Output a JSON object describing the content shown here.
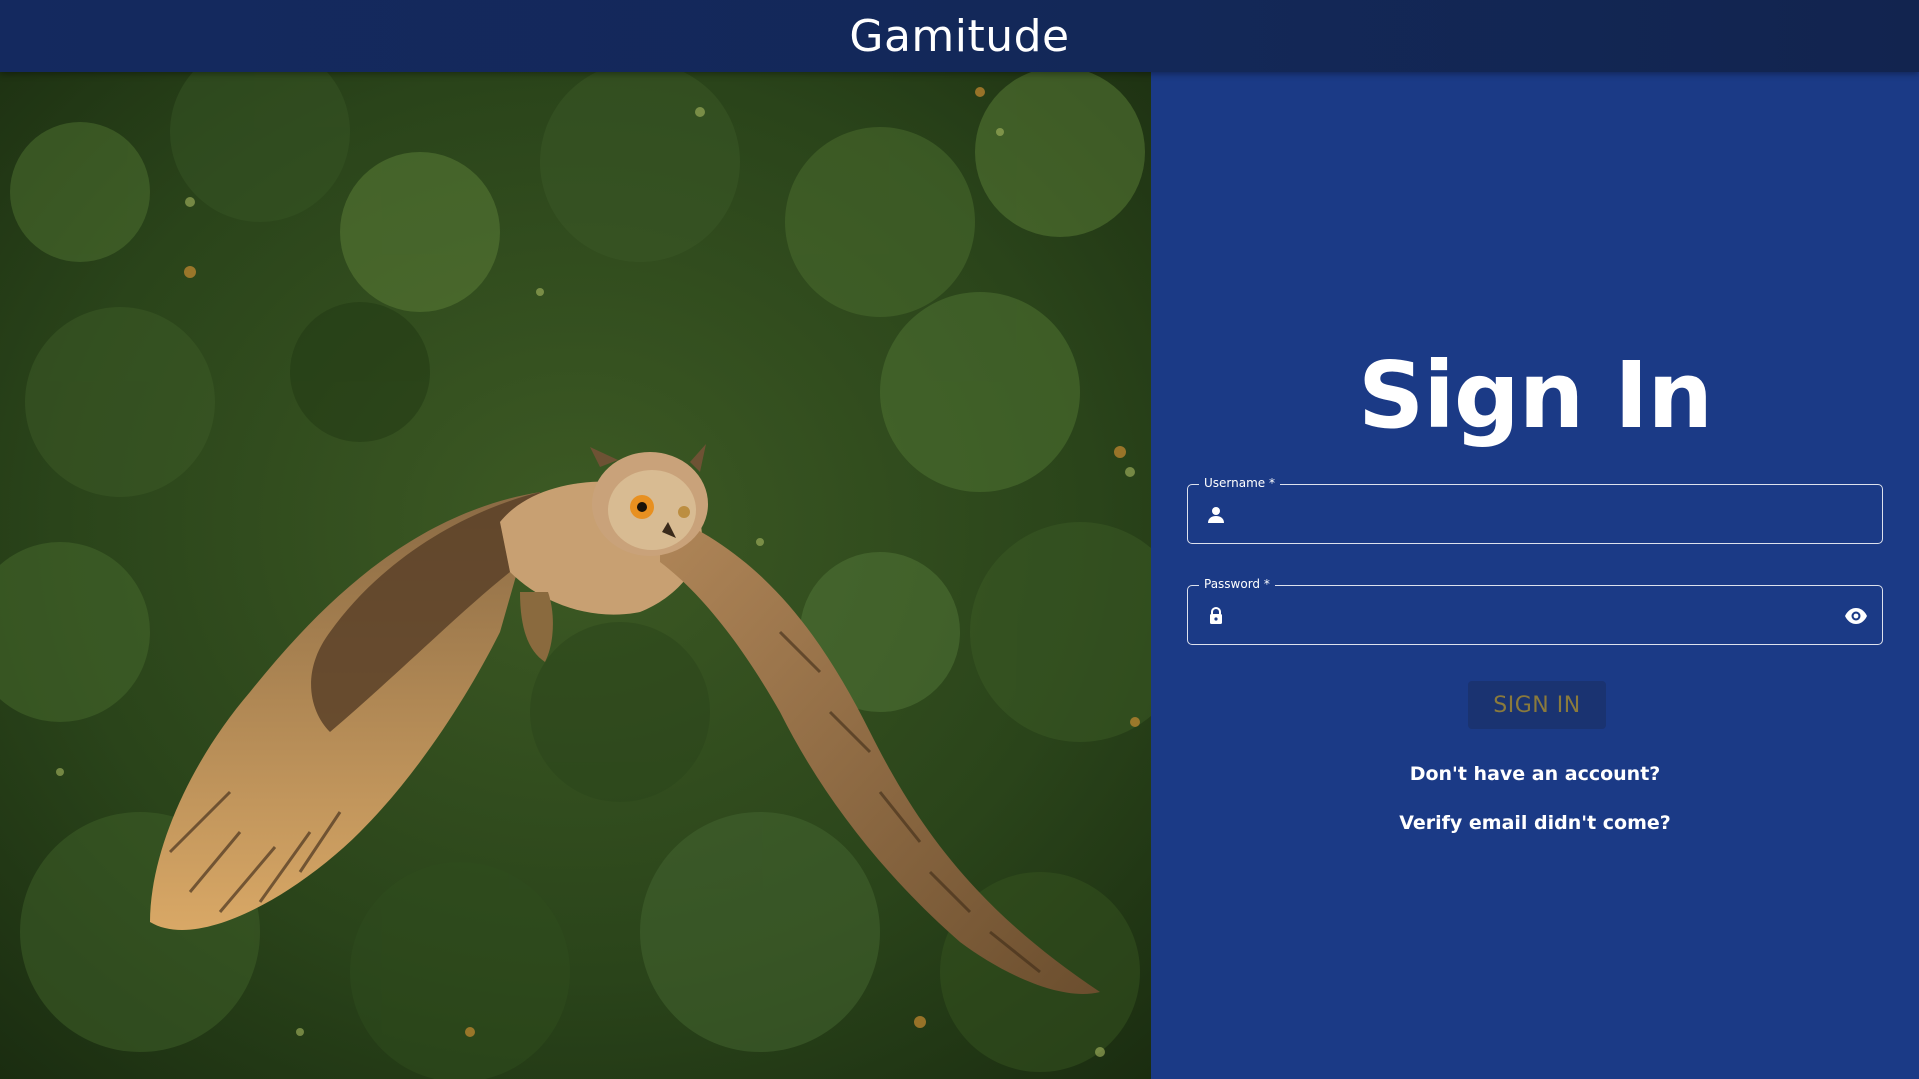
{
  "header": {
    "app_title": "Gamitude"
  },
  "hero": {
    "subject": "owl-in-flight-photo"
  },
  "form": {
    "heading": "Sign In",
    "username": {
      "label": "Username *",
      "value": "",
      "placeholder": "",
      "icon": "person-icon"
    },
    "password": {
      "label": "Password *",
      "value": "",
      "placeholder": "",
      "icon": "lock-icon",
      "toggle_icon": "eye-icon"
    },
    "submit_label": "SIGN IN",
    "register_link": "Don't have an account?",
    "verify_link": "Verify email didn't come?"
  },
  "colors": {
    "header_bg": "#132858",
    "panel_bg": "#1b3a86",
    "button_bg": "#1a3371",
    "button_text": "#8a7a3c",
    "text": "#ffffff"
  }
}
